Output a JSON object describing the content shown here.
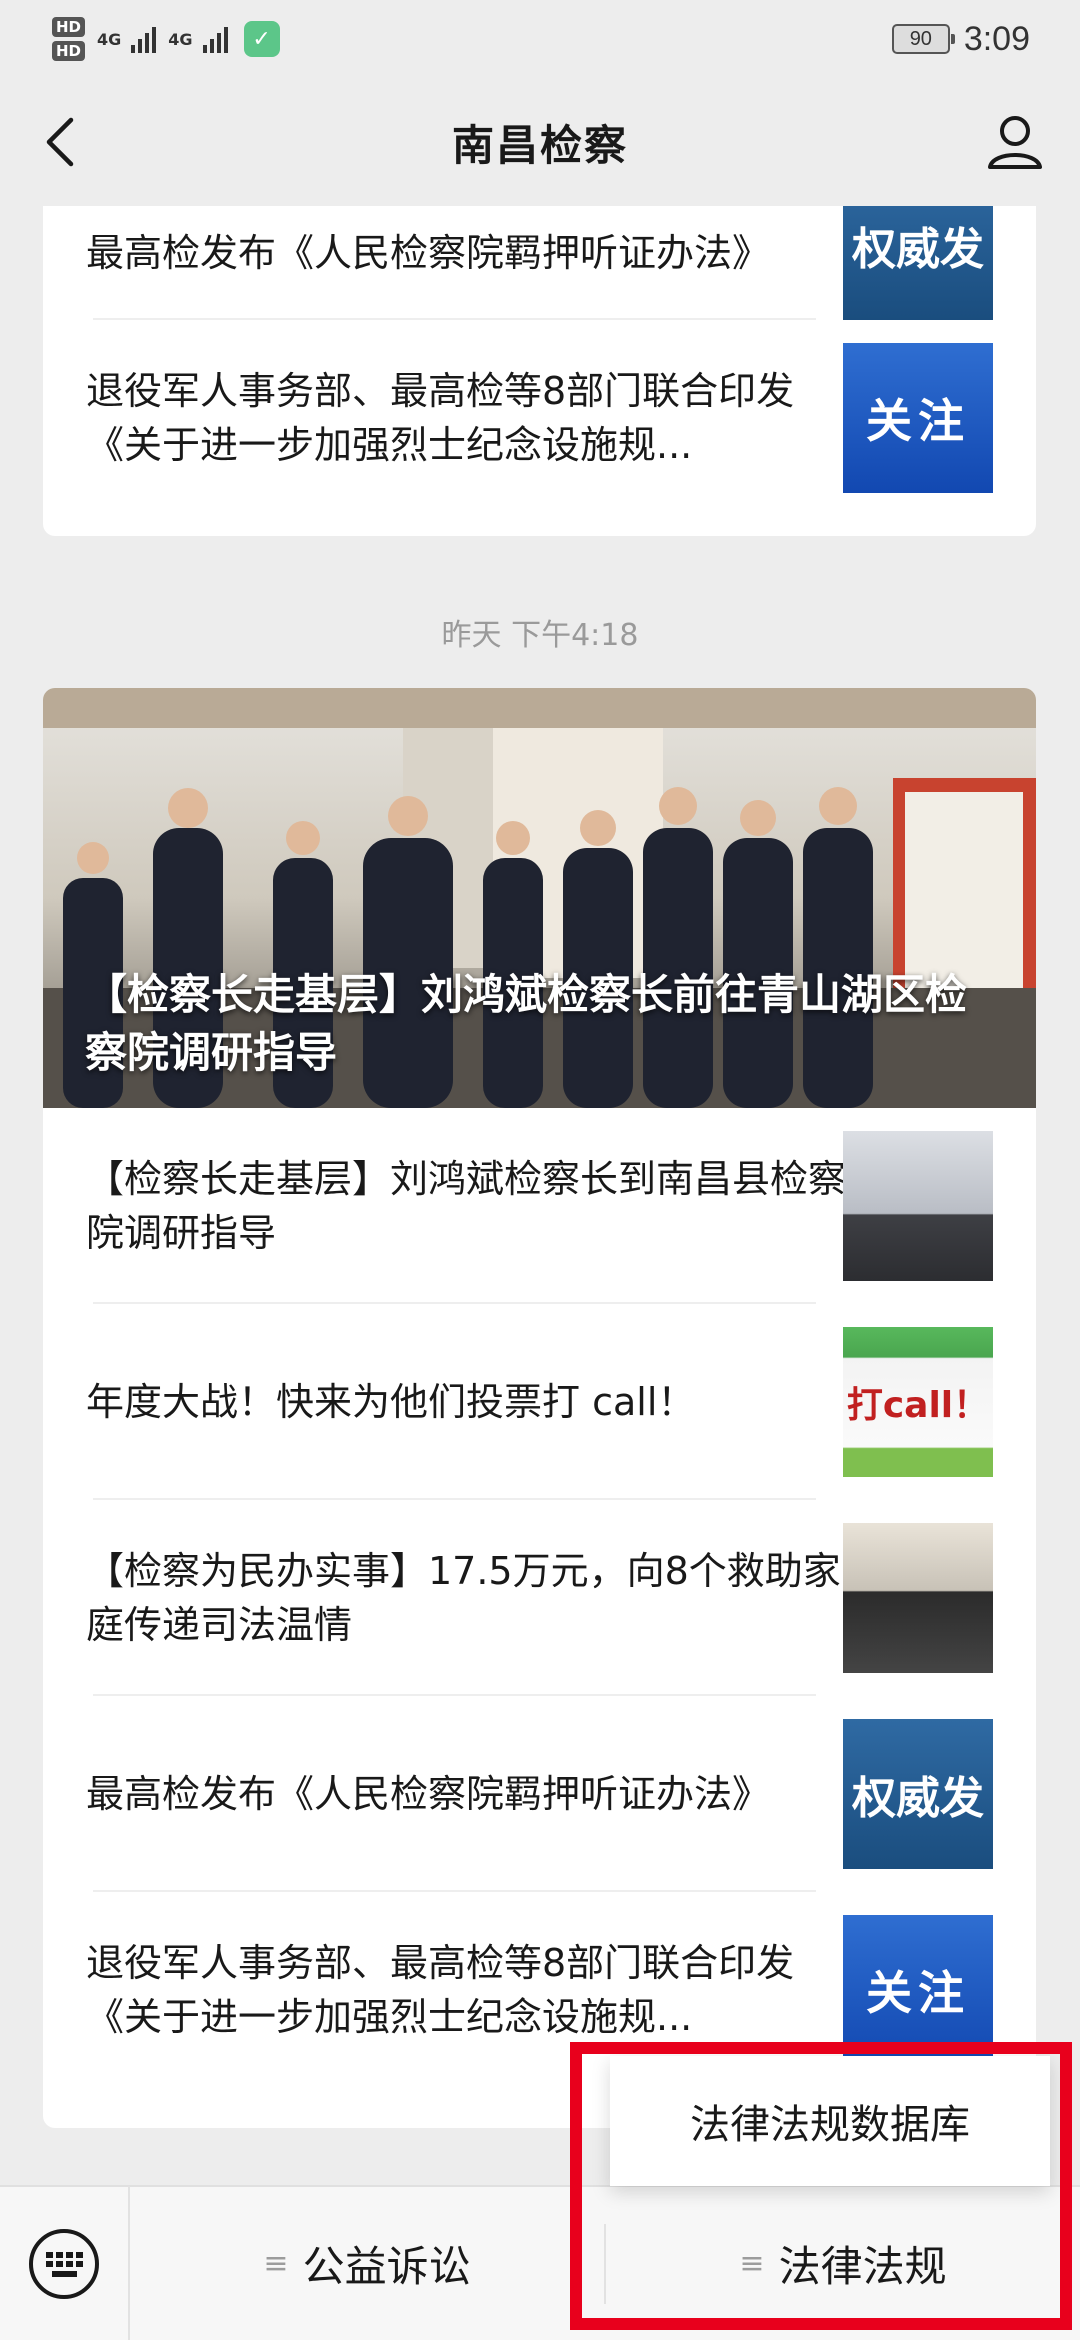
{
  "status_bar": {
    "hd1": "HD",
    "hd2": "HD",
    "network1": "4G",
    "network2": "4G",
    "battery": "90",
    "time": "3:09"
  },
  "nav": {
    "title": "南昌检察"
  },
  "card1": {
    "items": [
      {
        "title": "最高检发布《人民检察院羁押听证办法》",
        "thumb_text": "权威发"
      },
      {
        "title": "退役军人事务部、最高检等8部门联合印发《关于进一步加强烈士纪念设施规...",
        "thumb_text": "关注"
      }
    ]
  },
  "timestamp": "昨天 下午4:18",
  "card2": {
    "hero_title": "【检察长走基层】刘鸿斌检察长前往青山湖区检察院调研指导",
    "items": [
      {
        "title": "【检察长走基层】刘鸿斌检察长到南昌县检察院调研指导",
        "thumb_text": ""
      },
      {
        "title": "年度大战！快来为他们投票打 call！",
        "thumb_text": "打call！"
      },
      {
        "title": "【检察为民办实事】17.5万元，向8个救助家庭传递司法温情",
        "thumb_text": ""
      },
      {
        "title": "最高检发布《人民检察院羁押听证办法》",
        "thumb_text": "权威发"
      },
      {
        "title": "退役军人事务部、最高检等8部门联合印发《关于进一步加强烈士纪念设施规...",
        "thumb_text": "关注"
      }
    ]
  },
  "bottom_menu": {
    "item1": "公益诉讼",
    "item2": "法律法规",
    "popup_item": "法律法规数据库",
    "ham_glyph": "≡"
  },
  "colors": {
    "highlight": "#e8001c",
    "background": "#ededed"
  }
}
